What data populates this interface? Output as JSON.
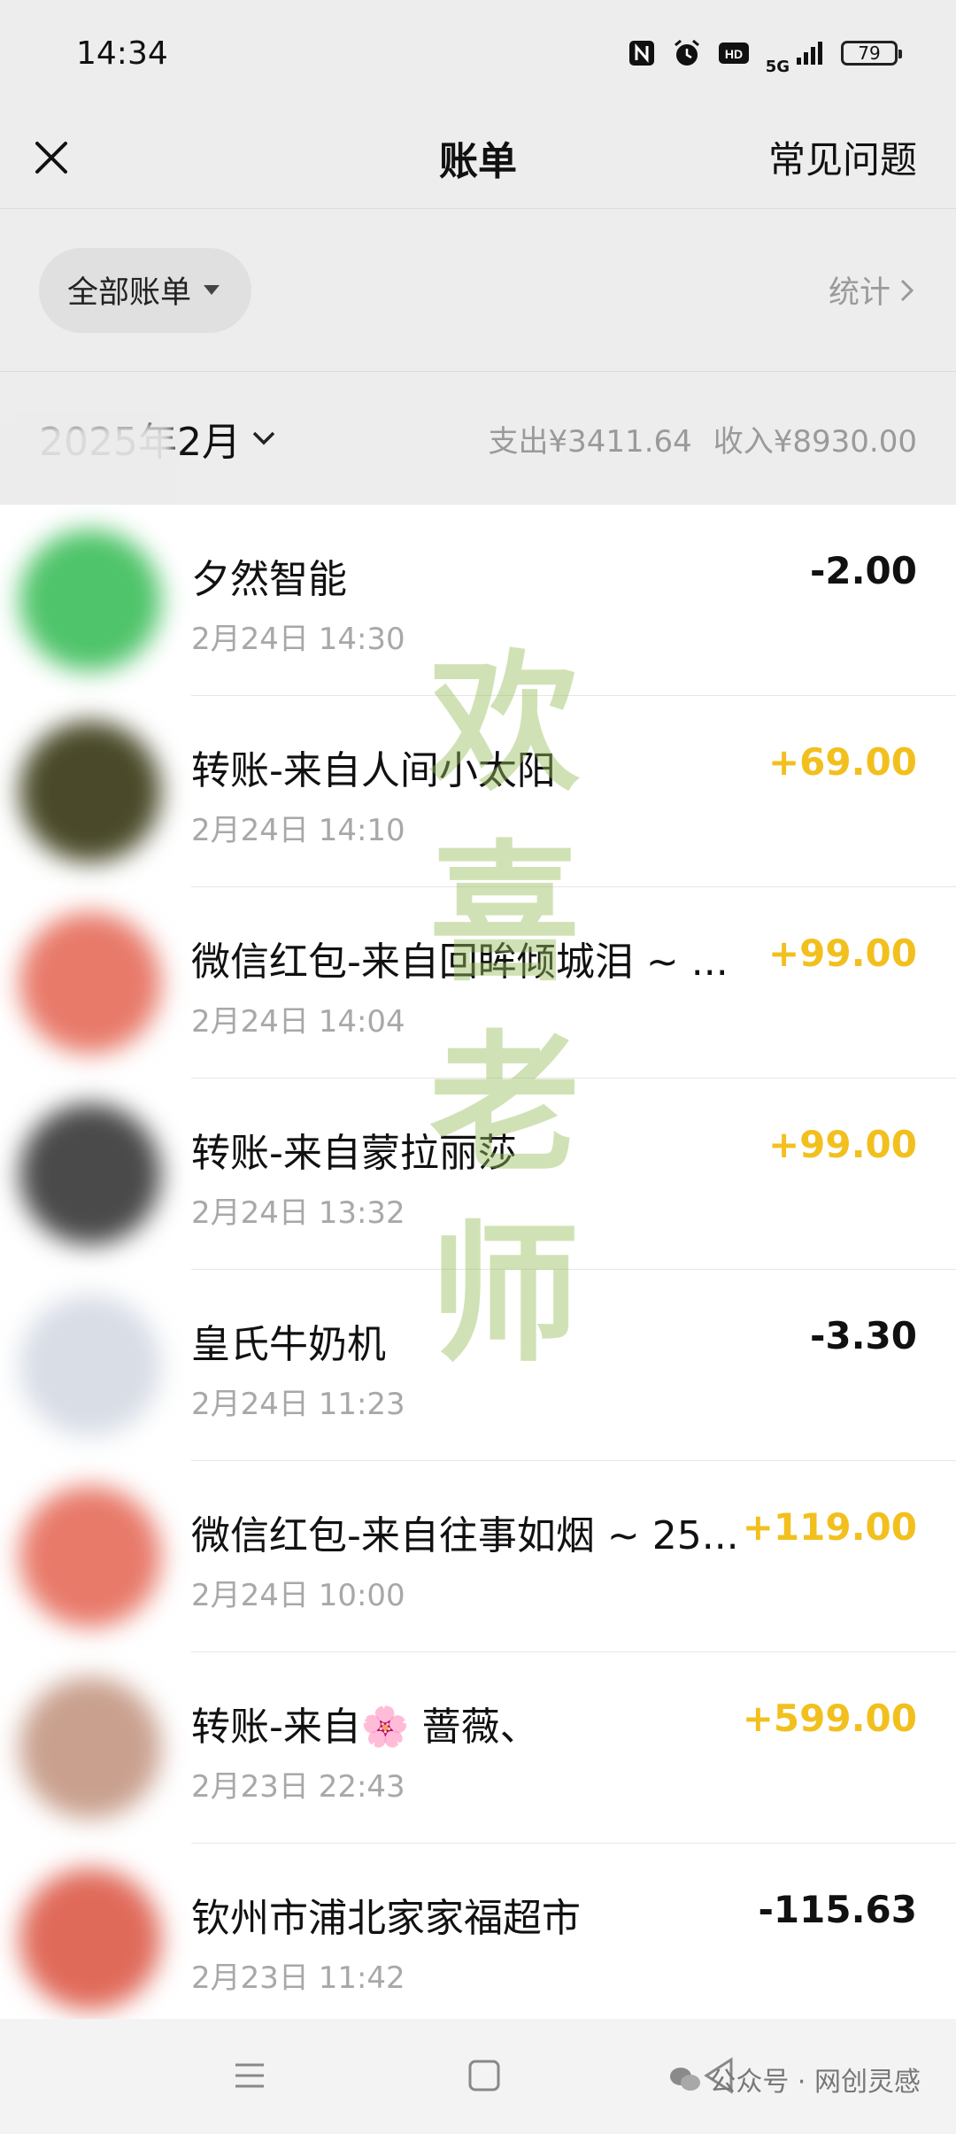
{
  "status_bar": {
    "time": "14:34",
    "network": "5G",
    "battery": "79"
  },
  "nav": {
    "title": "账单",
    "faq_label": "常见问题"
  },
  "filter": {
    "all_bills_label": "全部账单",
    "stats_label": "统计"
  },
  "month": {
    "label": "2025年2月",
    "expense_summary": "支出¥3411.64",
    "income_summary": "收入¥8930.00"
  },
  "transactions": [
    {
      "title": "夕然智能",
      "time": "2月24日 14:30",
      "amount": "-2.00",
      "type": "out",
      "avatar_color": "#4fc46a"
    },
    {
      "title": "转账-来自人间小太阳",
      "time": "2月24日 14:10",
      "amount": "+69.00",
      "type": "in",
      "avatar_color": "#4a4a2a"
    },
    {
      "title": "微信红包-来自回眸倾城泪 ~ ...",
      "time": "2月24日 14:04",
      "amount": "+99.00",
      "type": "in",
      "avatar_color": "#e87a6a"
    },
    {
      "title": "转账-来自蒙拉丽莎",
      "time": "2月24日 13:32",
      "amount": "+99.00",
      "type": "in",
      "avatar_color": "#4a4a4a"
    },
    {
      "title": "皇氏牛奶机",
      "time": "2月24日 11:23",
      "amount": "-3.30",
      "type": "out",
      "avatar_color": "#d8dde6"
    },
    {
      "title": "微信红包-来自往事如烟 ~ 25...",
      "time": "2月24日 10:00",
      "amount": "+119.00",
      "type": "in",
      "avatar_color": "#e87a6a"
    },
    {
      "title": "转账-来自🌸 蔷薇、",
      "time": "2月23日 22:43",
      "amount": "+599.00",
      "type": "in",
      "avatar_color": "#c9a08e"
    },
    {
      "title": "钦州市浦北家家福超市",
      "time": "2月23日 11:42",
      "amount": "-115.63",
      "type": "out",
      "avatar_color": "#e06a5a"
    }
  ],
  "watermark": {
    "chars": [
      "欢",
      "喜",
      "老",
      "师"
    ]
  },
  "footer": {
    "mark": "公众号 · 网创灵感"
  }
}
